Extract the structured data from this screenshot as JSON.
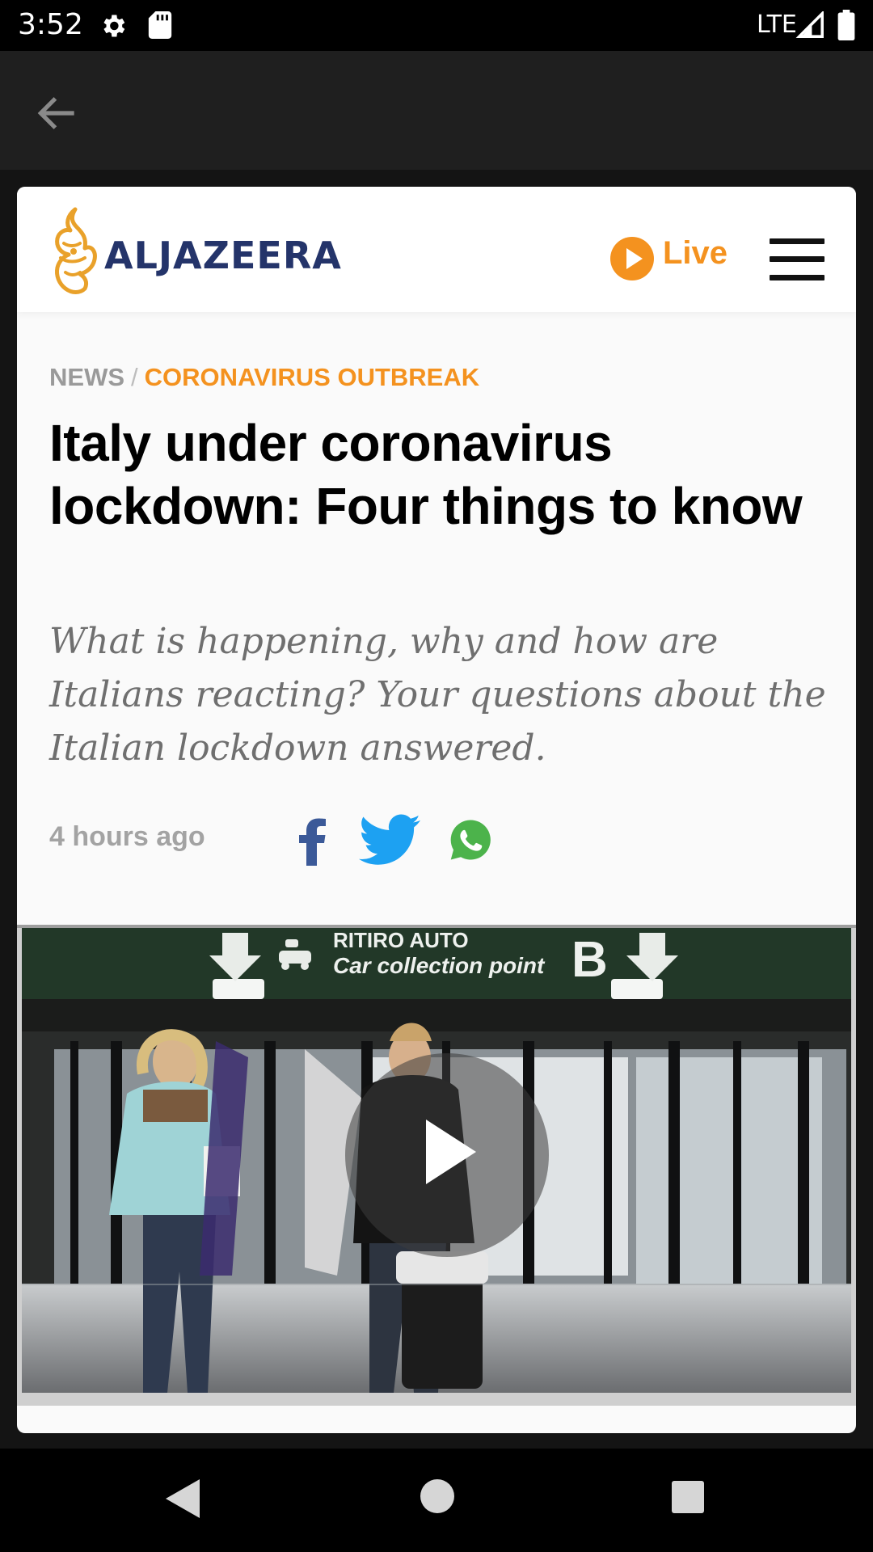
{
  "status_bar": {
    "time": "3:52",
    "network": "LTE",
    "icons": [
      "gear-icon",
      "sd-card-icon",
      "signal-icon",
      "battery-icon"
    ]
  },
  "app_bar": {
    "back_icon": "arrow-left-icon"
  },
  "site": {
    "logo_text": "ALJAZEERA",
    "live_label": "Live",
    "menu_icon": "hamburger-menu-icon",
    "brand_color": "#f4921f",
    "logo_color": "#24346a"
  },
  "article": {
    "breadcrumb": {
      "section": "NEWS",
      "separator": "/",
      "topic": "CORONAVIRUS OUTBREAK"
    },
    "headline": "Italy under coronavirus lockdown: Four things to know",
    "standfirst": "What is happening, why and how are Italians reacting? Your questions about the Italian lockdown answered.",
    "published": "4 hours ago",
    "share": [
      "facebook-icon",
      "twitter-icon",
      "whatsapp-icon"
    ]
  },
  "media": {
    "sign_line1": "RITIRO AUTO",
    "sign_line2": "Car collection point",
    "sign_letter": "B",
    "play_icon": "play-icon"
  },
  "nav_bar": {
    "icons": [
      "back-triangle-icon",
      "home-circle-icon",
      "recents-square-icon"
    ]
  }
}
